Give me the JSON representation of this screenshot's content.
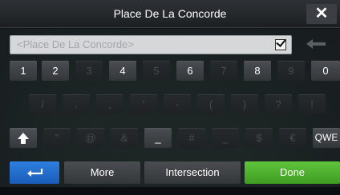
{
  "header": {
    "title": "Place De La Concorde",
    "close_label": "✕"
  },
  "search": {
    "value": "",
    "placeholder": "<Place De La Concorde>"
  },
  "icons": {
    "accept": "checkbox-icon",
    "backspace": "arrow-left-icon",
    "shift": "arrow-up-icon",
    "back": "return-arrow-icon",
    "colors": {
      "back_button": "#1f6fd6",
      "done_button": "#4caf2e",
      "key": "#3f4347",
      "key_disabled": "#23272a"
    }
  },
  "keyboard": {
    "row1": [
      "1",
      "2",
      "3",
      "4",
      "5",
      "6",
      "7",
      "8",
      "9",
      "0"
    ],
    "row2": [
      "/",
      ".",
      ",",
      "'",
      "-",
      "(",
      ")",
      "?",
      "!"
    ],
    "row3": [
      "\"",
      "@",
      "&",
      "_",
      "#",
      "_",
      "$",
      "€"
    ],
    "mode_key": "QWE"
  },
  "actions": {
    "more": "More",
    "intersection": "Intersection",
    "done": "Done"
  }
}
